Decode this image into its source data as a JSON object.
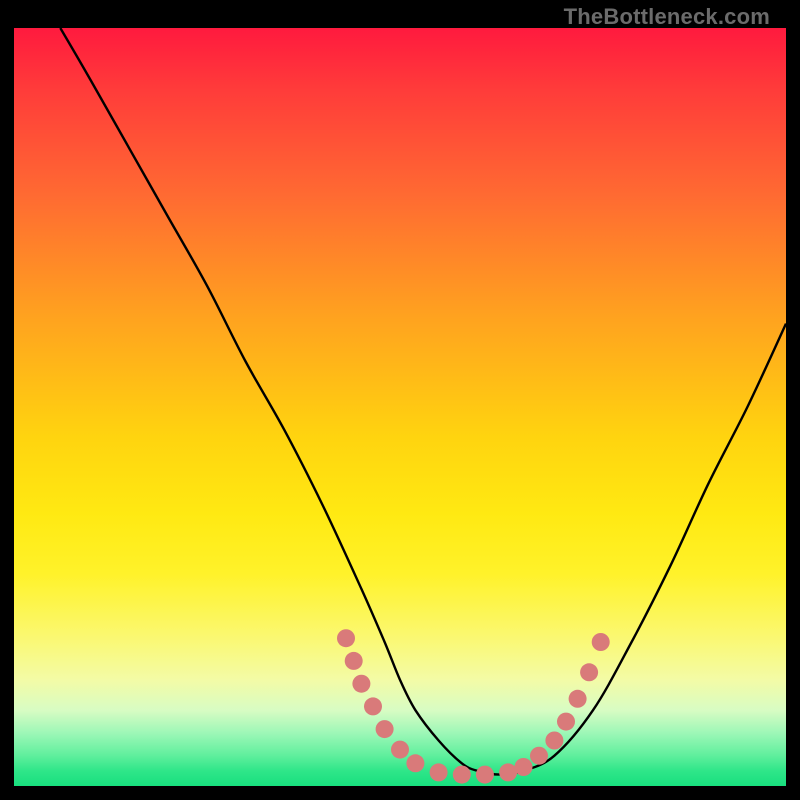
{
  "watermark": {
    "text": "TheBottleneck.com"
  },
  "chart_data": {
    "type": "line",
    "title": "",
    "xlabel": "",
    "ylabel": "",
    "xlim": [
      0,
      100
    ],
    "ylim": [
      0,
      100
    ],
    "series": [
      {
        "name": "curve",
        "x": [
          6,
          10,
          15,
          20,
          25,
          30,
          35,
          40,
          45,
          48,
          50,
          52,
          55,
          58,
          60,
          63,
          66,
          70,
          75,
          80,
          85,
          90,
          95,
          100
        ],
        "y": [
          100,
          93,
          84,
          75,
          66,
          56,
          47,
          37,
          26,
          19,
          14,
          10,
          6,
          3,
          2,
          1.5,
          2,
          4,
          10,
          19,
          29,
          40,
          50,
          61
        ]
      }
    ],
    "markers": [
      {
        "x": 43.0,
        "y": 19.5
      },
      {
        "x": 44.0,
        "y": 16.5
      },
      {
        "x": 45.0,
        "y": 13.5
      },
      {
        "x": 46.5,
        "y": 10.5
      },
      {
        "x": 48.0,
        "y": 7.5
      },
      {
        "x": 50.0,
        "y": 4.8
      },
      {
        "x": 52.0,
        "y": 3.0
      },
      {
        "x": 55.0,
        "y": 1.8
      },
      {
        "x": 58.0,
        "y": 1.5
      },
      {
        "x": 61.0,
        "y": 1.5
      },
      {
        "x": 64.0,
        "y": 1.8
      },
      {
        "x": 66.0,
        "y": 2.5
      },
      {
        "x": 68.0,
        "y": 4.0
      },
      {
        "x": 70.0,
        "y": 6.0
      },
      {
        "x": 71.5,
        "y": 8.5
      },
      {
        "x": 73.0,
        "y": 11.5
      },
      {
        "x": 74.5,
        "y": 15.0
      },
      {
        "x": 76.0,
        "y": 19.0
      }
    ],
    "marker_color": "#d97a7a",
    "curve_color": "#000000"
  }
}
